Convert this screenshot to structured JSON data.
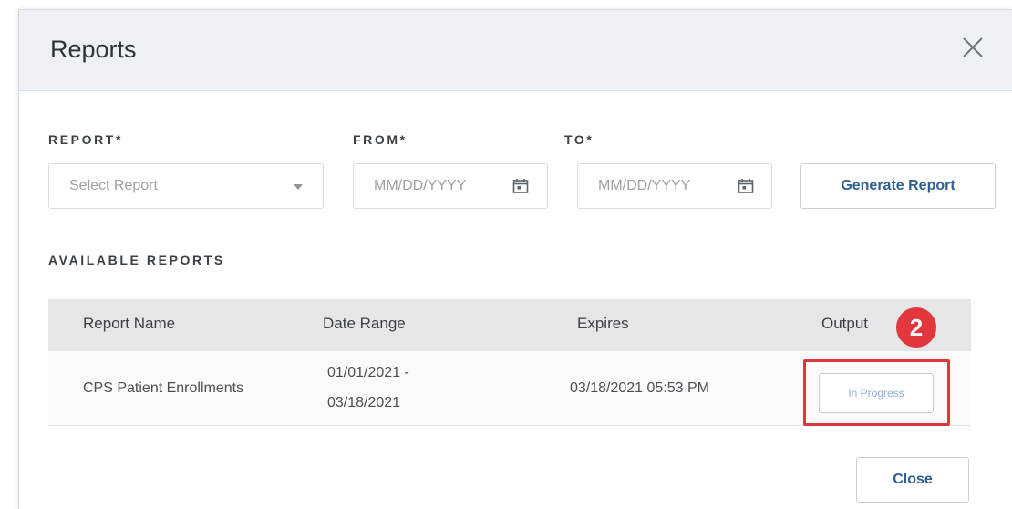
{
  "dialog": {
    "title": "Reports",
    "close_icon": "close-icon"
  },
  "form": {
    "report_label": "REPORT*",
    "report_placeholder": "Select Report",
    "from_label": "FROM*",
    "from_placeholder": "MM/DD/YYYY",
    "to_label": "TO*",
    "to_placeholder": "MM/DD/YYYY",
    "calendar_icon": "calendar-icon",
    "generate_label": "Generate Report"
  },
  "available": {
    "heading": "AVAILABLE REPORTS",
    "columns": [
      "Report Name",
      "Date Range",
      "Expires",
      "Output"
    ],
    "rows": [
      {
        "name": "CPS Patient Enrollments",
        "date_range_start": "01/01/2021 -",
        "date_range_end": "03/18/2021",
        "expires": "03/18/2021 05:53 PM",
        "output": "In Progress"
      }
    ]
  },
  "annotation": {
    "step": "2",
    "color": "#e2373c"
  },
  "footer": {
    "close_label": "Close"
  },
  "colors": {
    "header_bg": "#edf1f6",
    "table_header_bg": "#e4e6e8",
    "button_text": "#2f5f93"
  }
}
